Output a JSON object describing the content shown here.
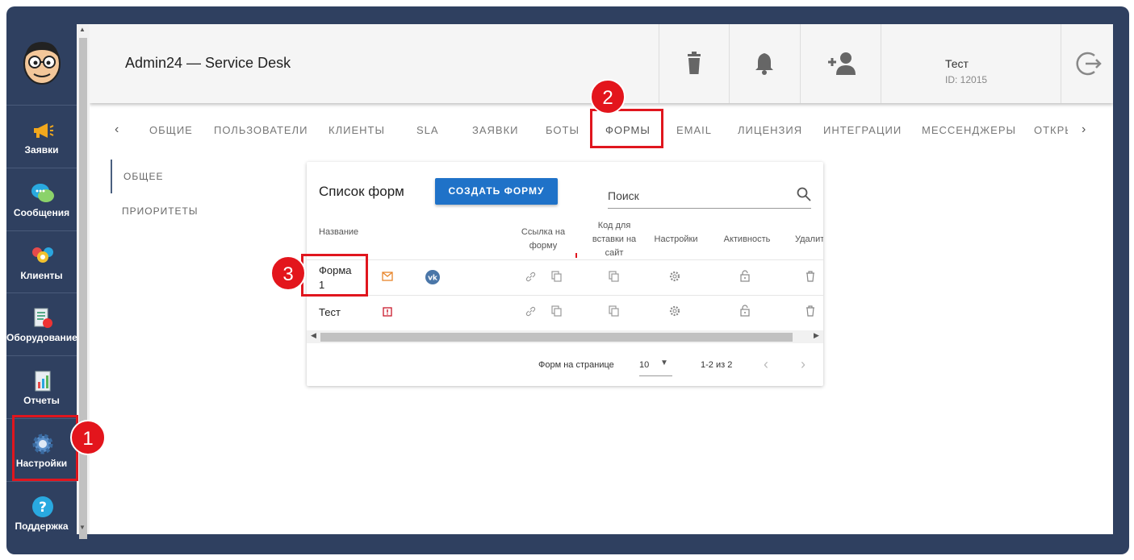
{
  "app": {
    "title": "Admin24 — Service Desk"
  },
  "user": {
    "name": "Тест",
    "id": "ID: 12015"
  },
  "sidebar": {
    "items": [
      {
        "label": "Заявки",
        "icon": "megaphone-icon"
      },
      {
        "label": "Сообщения",
        "icon": "chat-bubbles-icon"
      },
      {
        "label": "Клиенты",
        "icon": "users-icon"
      },
      {
        "label": "Оборудование",
        "icon": "equipment-icon"
      },
      {
        "label": "Отчеты",
        "icon": "report-icon"
      },
      {
        "label": "Настройки",
        "icon": "gear-icon"
      },
      {
        "label": "Поддержка",
        "icon": "help-icon"
      }
    ]
  },
  "tabs": [
    "ОБЩИЕ",
    "ПОЛЬЗОВАТЕЛИ",
    "КЛИЕНТЫ",
    "SLA",
    "ЗАЯВКИ",
    "БОТЫ",
    "ФОРМЫ",
    "EMAIL",
    "ЛИЦЕНЗИЯ",
    "ИНТЕГРАЦИИ",
    "МЕССЕНДЖЕРЫ",
    "ОТКРЫ"
  ],
  "active_tab": "ФОРМЫ",
  "section_nav": [
    "ОБЩЕЕ",
    "ПРИОРИТЕТЫ"
  ],
  "forms": {
    "title": "Список форм",
    "create_label": "СОЗДАТЬ ФОРМУ",
    "search_placeholder": "Поиск",
    "columns": {
      "name": "Название",
      "link": "Ссылка на форму",
      "embed": "Код для вставки на сайт",
      "settings": "Настройки",
      "active": "Активность",
      "delete": "Удалить"
    },
    "rows": [
      {
        "name_line1": "Форма",
        "name_line2": "1"
      },
      {
        "name_line1": "Тест",
        "name_line2": ""
      }
    ],
    "pager": {
      "per_page_label": "Форм на странице",
      "per_page": "10",
      "range": "1-2 из 2"
    }
  },
  "annotations": [
    "1",
    "2",
    "3"
  ],
  "colors": {
    "frame": "#2f4060",
    "accent": "#1f72c8",
    "highlight": "#e0161e"
  }
}
